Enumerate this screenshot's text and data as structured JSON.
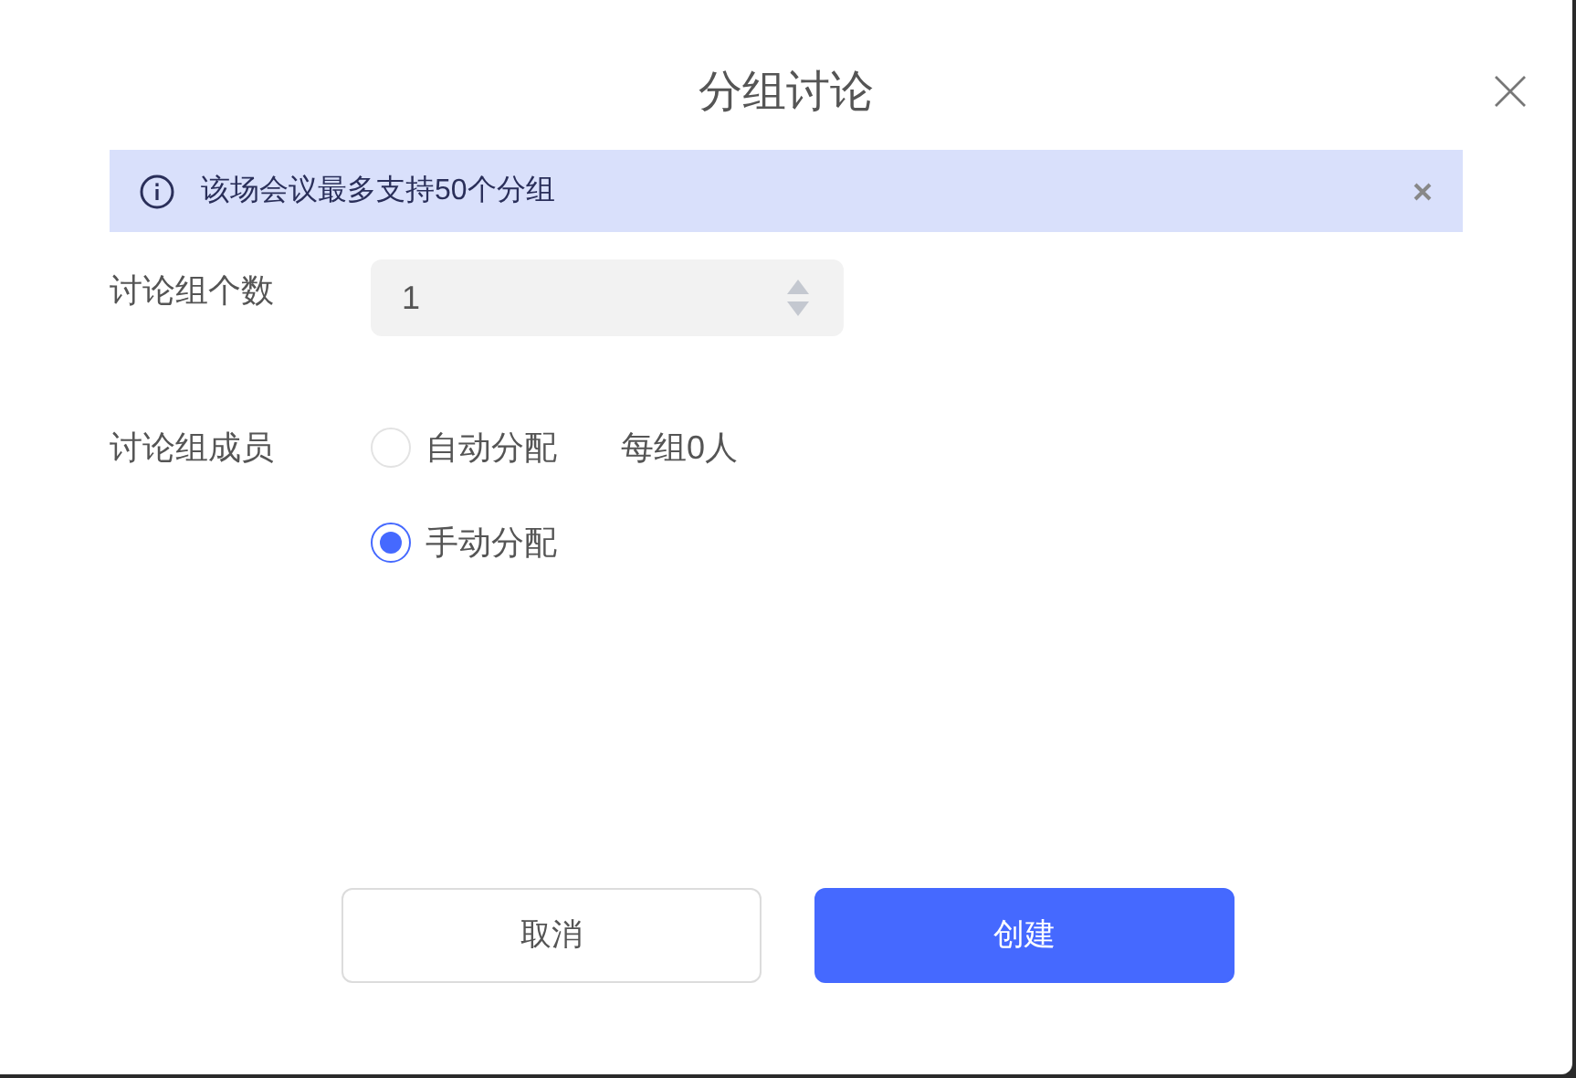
{
  "dialog": {
    "title": "分组讨论"
  },
  "notice": {
    "text": "该场会议最多支持50个分组"
  },
  "group_count": {
    "label": "讨论组个数",
    "value": "1"
  },
  "members": {
    "label": "讨论组成员",
    "options": [
      {
        "label": "自动分配",
        "selected": false,
        "note": "每组0人"
      },
      {
        "label": "手动分配",
        "selected": true
      }
    ]
  },
  "buttons": [
    {
      "label": "取消",
      "kind": "secondary"
    },
    {
      "label": "创建",
      "kind": "primary"
    }
  ]
}
